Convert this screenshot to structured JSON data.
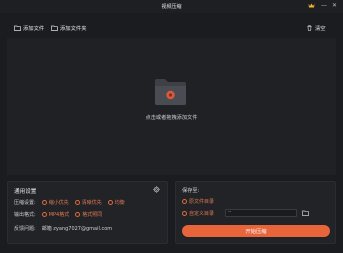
{
  "window": {
    "title": "视频压缩",
    "minimize": "—",
    "close": "✕"
  },
  "toolbar": {
    "add_file": "添加文件",
    "add_folder": "添加文件夹",
    "clear": "清空"
  },
  "dropzone": {
    "hint": "点击或者拖拽添加文件"
  },
  "settings": {
    "title": "通用设置",
    "compress_label": "压缩设置:",
    "compress_options": [
      "缩小优先",
      "清晰优先",
      "均衡"
    ],
    "format_label": "输出格式:",
    "format_options": [
      "MP4格式",
      "格式照同"
    ],
    "feedback_label": "反馈问题:",
    "feedback_value": "邮箱 zyang7027@gmail.com"
  },
  "save": {
    "label": "保存至:",
    "option_original": "原文件目录",
    "option_custom": "自定义目录",
    "path_value": "--",
    "start_button": "开始压缩"
  },
  "colors": {
    "accent": "#e8643a",
    "background": "#1b1c20",
    "panel": "#222327"
  }
}
